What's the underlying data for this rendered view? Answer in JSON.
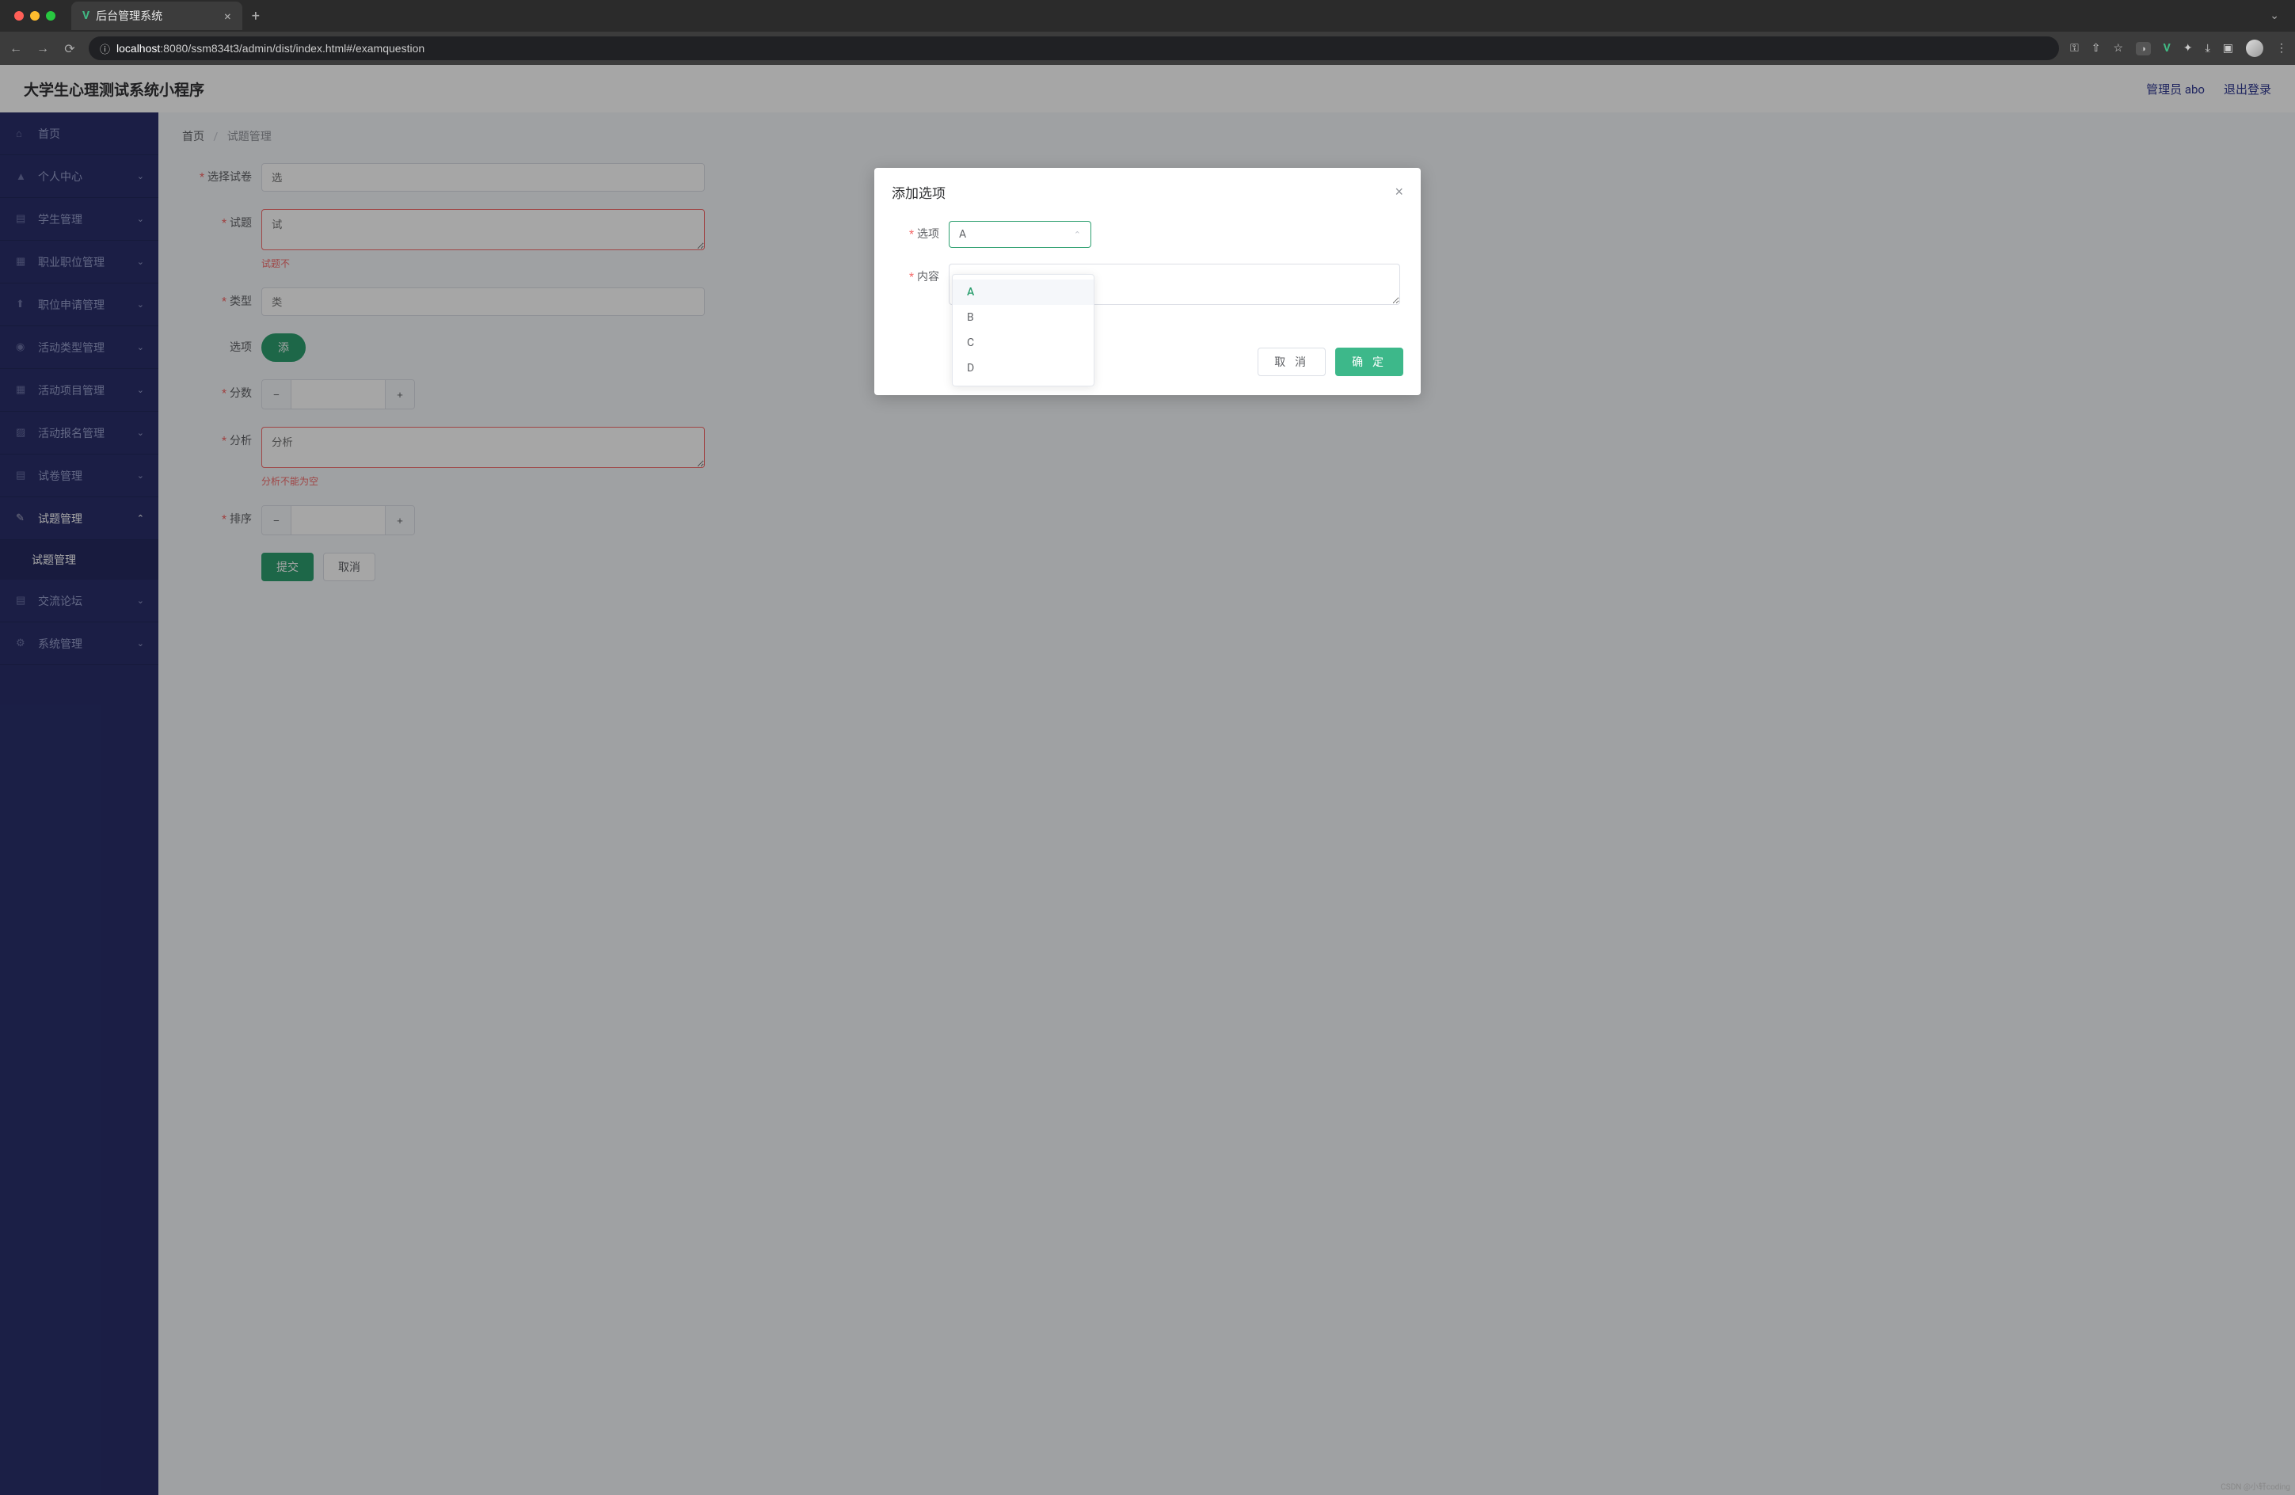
{
  "browser": {
    "tab_title": "后台管理系统",
    "url_host": "localhost",
    "url_path": ":8080/ssm834t3/admin/dist/index.html#/examquestion"
  },
  "header": {
    "app_title": "大学生心理测试系统小程序",
    "admin_label": "管理员 abo",
    "logout_label": "退出登录"
  },
  "sidebar": {
    "items": [
      {
        "label": "首页",
        "icon": "home",
        "expandable": false
      },
      {
        "label": "个人中心",
        "icon": "user",
        "expandable": true
      },
      {
        "label": "学生管理",
        "icon": "bars",
        "expandable": true
      },
      {
        "label": "职业职位管理",
        "icon": "list",
        "expandable": true
      },
      {
        "label": "职位申请管理",
        "icon": "upload",
        "expandable": true
      },
      {
        "label": "活动类型管理",
        "icon": "bulb",
        "expandable": true
      },
      {
        "label": "活动项目管理",
        "icon": "grid",
        "expandable": true
      },
      {
        "label": "活动报名管理",
        "icon": "chart",
        "expandable": true
      },
      {
        "label": "试卷管理",
        "icon": "doc",
        "expandable": true
      },
      {
        "label": "试题管理",
        "icon": "edit",
        "expandable": true,
        "expanded": true,
        "sub": "试题管理"
      },
      {
        "label": "交流论坛",
        "icon": "chat",
        "expandable": true
      },
      {
        "label": "系统管理",
        "icon": "gear",
        "expandable": true
      }
    ]
  },
  "breadcrumb": {
    "home": "首页",
    "current": "试题管理"
  },
  "form": {
    "select_paper": {
      "label": "选择试卷",
      "placeholder": "选"
    },
    "question": {
      "label": "试题",
      "placeholder": "试",
      "error": "试题不"
    },
    "type": {
      "label": "类型",
      "placeholder": "类"
    },
    "options": {
      "label": "选项",
      "add_btn": "添"
    },
    "score": {
      "label": "分数"
    },
    "analysis": {
      "label": "分析",
      "placeholder": "分析",
      "error": "分析不能为空"
    },
    "sort": {
      "label": "排序"
    },
    "submit": "提交",
    "cancel": "取消"
  },
  "modal": {
    "title": "添加选项",
    "option_label": "选项",
    "option_value": "A",
    "content_label": "内容",
    "cancel": "取 消",
    "ok": "确 定",
    "dropdown": [
      "A",
      "B",
      "C",
      "D"
    ]
  },
  "watermark": "CSDN @小轩coding"
}
